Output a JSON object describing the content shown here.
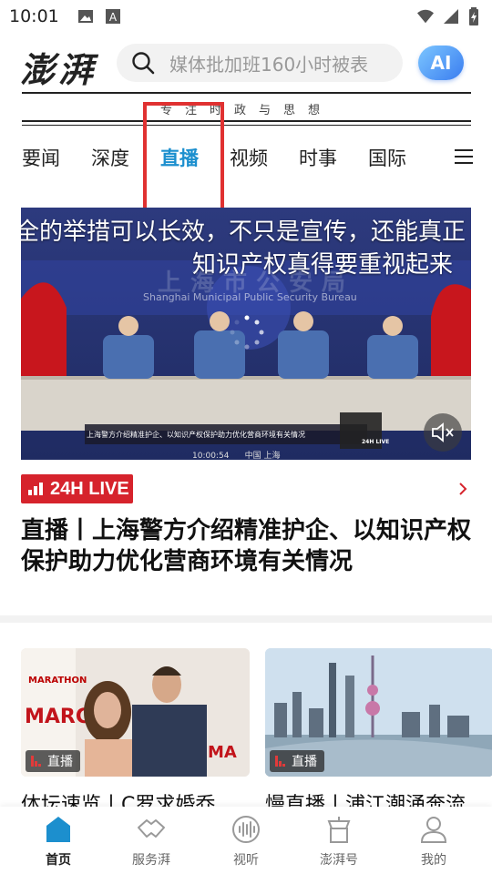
{
  "status_bar": {
    "time": "10:01",
    "left_icons": [
      "image-icon",
      "a-icon"
    ],
    "right_icons": [
      "wifi-icon",
      "signal-icon",
      "battery-icon"
    ]
  },
  "header": {
    "logo_text": "澎湃",
    "search_placeholder": "媒体批加班160小时被表",
    "ai_label": "AI",
    "slogan": "专注时政与思想"
  },
  "tabs": [
    {
      "label": "要闻",
      "active": false
    },
    {
      "label": "深度",
      "active": false
    },
    {
      "label": "直播",
      "active": true
    },
    {
      "label": "视频",
      "active": false
    },
    {
      "label": "时事",
      "active": false
    },
    {
      "label": "国际",
      "active": false
    }
  ],
  "video": {
    "caption_line1": "全的举措可以长效，不只是宣传，还能真正",
    "caption_line2": "知识产权真得要重视起来",
    "backdrop_title": "上海市公安局",
    "backdrop_subtitle": "Shanghai Municipal Public Security Bureau",
    "ticker": "上海警方介绍精准护企、以知识产权保护助力优化营商环境有关情况",
    "timestamp": "10:00:54",
    "location": "中国 上海",
    "corner_logo": "24H LIVE"
  },
  "live": {
    "badge_text": "24H LIVE",
    "headline": "直播丨上海警方介绍精准护企、以知识产权保护助力优化营商环境有关情况"
  },
  "cards": [
    {
      "tag": "直播",
      "title": "体坛速览丨C罗求婚乔"
    },
    {
      "tag": "直播",
      "title": "慢直播丨浦江潮涌奔流"
    }
  ],
  "bottom_nav": [
    {
      "label": "首页",
      "icon": "home-icon",
      "active": true
    },
    {
      "label": "服务湃",
      "icon": "handshake-icon",
      "active": false
    },
    {
      "label": "视听",
      "icon": "audio-icon",
      "active": false
    },
    {
      "label": "澎湃号",
      "icon": "account-icon",
      "active": false
    },
    {
      "label": "我的",
      "icon": "profile-icon",
      "active": false
    }
  ],
  "colors": {
    "accent": "#1c8fce",
    "live_red": "#d6232c",
    "highlight": "#e03131"
  }
}
